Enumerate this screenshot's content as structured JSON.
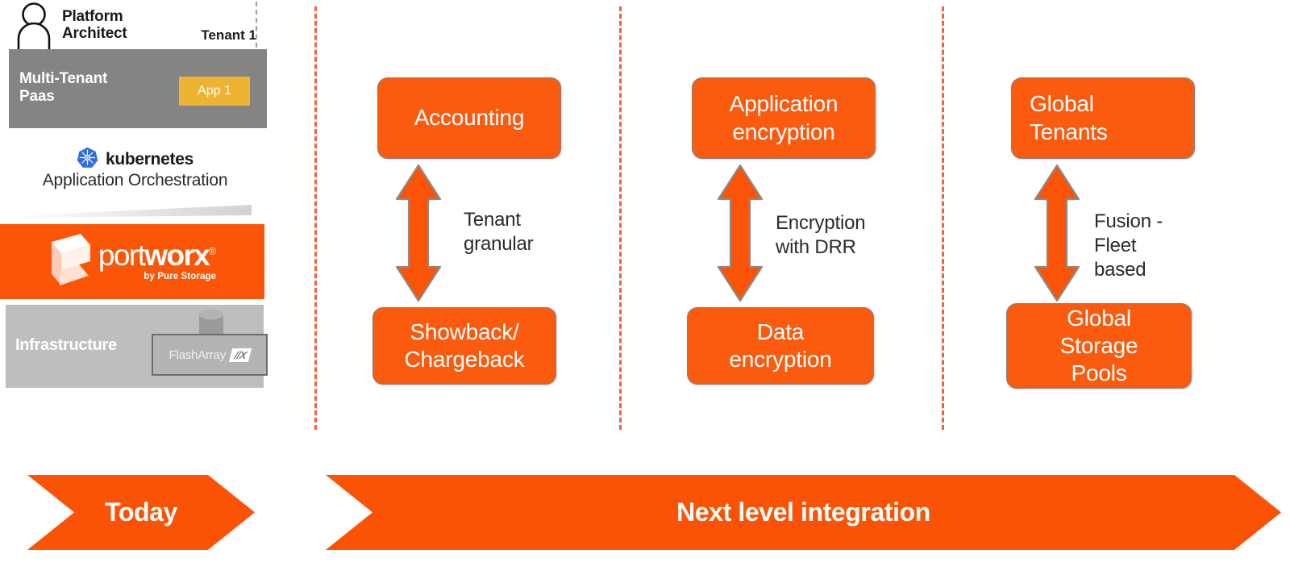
{
  "theme": {
    "orange": "#FA5B0F",
    "orange_banner": "#FA5305",
    "portworx_orange": "#FB5607",
    "dash_separator": "#F4603C",
    "paas_gray": "#848484",
    "infra_gray": "#BEBEBE",
    "app_amber": "#EFB334",
    "kubernetes_blue": "#326CE5",
    "box_stroke": "#808080"
  },
  "today_column": {
    "persona": "Platform\nArchitect",
    "persona_line1": "Platform",
    "persona_line2": "Architect",
    "tenant_label": "Tenant 1",
    "paas_line1": "Multi-Tenant",
    "paas_line2": "Paas",
    "app_chip": "App 1",
    "orchestration_logo": "kubernetes",
    "orchestration_caption": "Application Orchestration",
    "storage_brand_part1": "port",
    "storage_brand_part2": "worx",
    "storage_brand_registered": "®",
    "storage_brand_tagline": "by Pure Storage",
    "infrastructure_label": "Infrastructure",
    "array_name": "FlashArray",
    "array_model": "//X"
  },
  "columns": [
    {
      "id": "accounting",
      "top_box": "Accounting",
      "caption_line1": "Tenant",
      "caption_line2": "granular",
      "caption": "Tenant granular",
      "bottom_box_line1": "Showback/",
      "bottom_box_line2": "Chargeback",
      "bottom_box": "Showback/ Chargeback",
      "arrow": "double-headed-vertical-arrow"
    },
    {
      "id": "encryption",
      "top_box_line1": "Application",
      "top_box_line2": "encryption",
      "top_box": "Application encryption",
      "caption_line1": "Encryption",
      "caption_line2": "with DRR",
      "caption": "Encryption with DRR",
      "bottom_box_line1": "Data",
      "bottom_box_line2": "encryption",
      "bottom_box": "Data encryption",
      "arrow": "double-headed-vertical-arrow"
    },
    {
      "id": "global",
      "top_box_line1": "Global",
      "top_box_line2": "Tenants",
      "top_box": "Global Tenants",
      "caption_line1": "Fusion -",
      "caption_line2": "Fleet",
      "caption_line3": "based",
      "caption": "Fusion - Fleet based",
      "bottom_box_line1": "Global",
      "bottom_box_line2": "Storage",
      "bottom_box_line3": "Pools",
      "bottom_box": "Global Storage Pools",
      "arrow": "double-headed-vertical-arrow"
    }
  ],
  "timeline": {
    "today_label": "Today",
    "next_label": "Next level integration"
  }
}
